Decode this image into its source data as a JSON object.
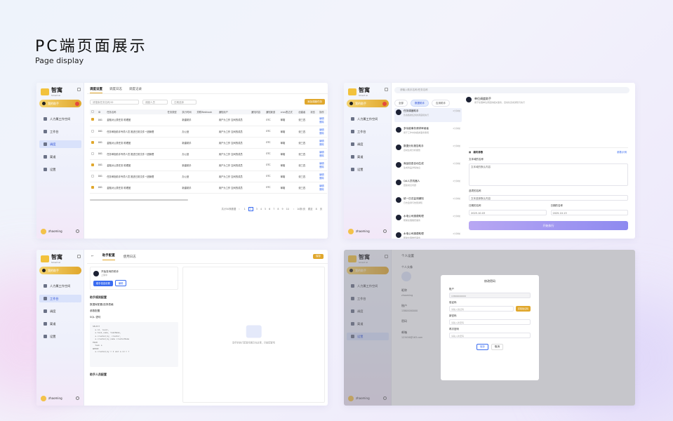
{
  "heading": {
    "title": "PC端页面展示",
    "subtitle": "Page display"
  },
  "brand": {
    "name": "智寓",
    "tagline": "Smart AI"
  },
  "sidebar": {
    "new_label": "我的助手",
    "items": [
      {
        "label": "人力属工作空间"
      },
      {
        "label": "工作台"
      },
      {
        "label": "调度"
      },
      {
        "label": "渠道"
      },
      {
        "label": "设置"
      }
    ],
    "user_name": "zhaoming"
  },
  "panel1": {
    "tabs": [
      "调度设置",
      "调度日志",
      "调度记录"
    ],
    "search_placeholder": "请搜索任务名称/ID",
    "filter_type": "调度人员",
    "filter_date": "日期选择",
    "add_label": "添加调度任务",
    "columns": [
      "ID",
      "任务名称",
      "任务类型",
      "执行时间",
      "关联Webhook",
      "通知用户",
      "通知内容",
      "通知渠道",
      "cron表达式",
      "创建者",
      "状态",
      "操作"
    ],
    "rows": [
      {
        "checked": true,
        "id": "001",
        "name": "金融对公类任务 助理团",
        "time": "新建助手",
        "users": "用户为工作 空间的成员",
        "channel": "OTC",
        "cron": "邮箱",
        "creator": "张三四",
        "op1": "编辑",
        "op2": "删除"
      },
      {
        "checked": false,
        "id": "001",
        "name": "任务审批助手专项人员 推进日常文件一团管理",
        "time": "办公室",
        "users": "用户为工作 空间的成员",
        "channel": "OTC",
        "cron": "邮箱",
        "creator": "张三四",
        "op1": "编辑",
        "op2": "删除"
      },
      {
        "checked": true,
        "id": "001",
        "name": "金融对公类任务 助理团",
        "time": "新建助手",
        "users": "用户为工作 空间的成员",
        "channel": "OTC",
        "cron": "邮箱",
        "creator": "张三四",
        "op1": "编辑",
        "op2": "删除"
      },
      {
        "checked": false,
        "id": "001",
        "name": "任务审批助手专项人员 推进日常文件一团管理",
        "time": "办公室",
        "users": "用户为工作 空间的成员",
        "channel": "OTC",
        "cron": "邮箱",
        "creator": "张三四",
        "op1": "编辑",
        "op2": "删除"
      },
      {
        "checked": true,
        "id": "001",
        "name": "金融对公类任务 助理团",
        "time": "新建助手",
        "users": "用户为工作 空间的成员",
        "channel": "OTC",
        "cron": "邮箱",
        "creator": "张三四",
        "op1": "编辑",
        "op2": "删除"
      },
      {
        "checked": false,
        "id": "001",
        "name": "任务审批助手专项人员 推进日常文件一团管理",
        "time": "办公室",
        "users": "用户为工作 空间的成员",
        "channel": "OTC",
        "cron": "邮箱",
        "creator": "张三四",
        "op1": "编辑",
        "op2": "删除"
      },
      {
        "checked": true,
        "id": "001",
        "name": "金融对公类任务 助理团",
        "time": "新建助手",
        "users": "用户为工作 空间的成员",
        "channel": "OTC",
        "cron": "邮箱",
        "creator": "张三四",
        "op1": "编辑",
        "op2": "删除"
      }
    ],
    "pager": {
      "total": "共计50条数据",
      "pages": [
        "1",
        "2",
        "3",
        "4",
        "5",
        "6",
        "7",
        "8",
        "9",
        "10"
      ],
      "current": "2",
      "size": "10条/页",
      "goto": "跳至",
      "page_no": "8",
      "page_unit": "页"
    }
  },
  "panel2": {
    "search_placeholder": "请输入助手名称/任务名称",
    "chips": [
      "全部",
      "数据助手",
      "应用助手"
    ],
    "assistants": [
      {
        "name": "任务调度助手",
        "desc": "负责各类任务的调度和执行",
        "time": "4分钟前"
      },
      {
        "name": "多功能事务请求审阅者",
        "desc": "用于工作中的各类事务审阅",
        "time": "4分钟前"
      },
      {
        "name": "数据分析报告助手",
        "desc": "自动生成分析报告",
        "time": "4分钟前"
      },
      {
        "name": "商品信息自动生成",
        "desc": "生成商品详情信息",
        "time": "4分钟前"
      },
      {
        "name": "QA人员机器人",
        "desc": "回答常见问题",
        "time": "4分钟前"
      },
      {
        "name": "统一日志监测通知",
        "desc": "日志监测与告警通知",
        "time": "4分钟前"
      },
      {
        "name": "水电公司缴费助理",
        "desc": "帮助处理缴费事务",
        "time": "4分钟前"
      },
      {
        "name": "水电公司缴费助理",
        "desc": "帮助处理缴费事务",
        "time": "4分钟前"
      }
    ],
    "detail": {
      "name": "单位调度助手",
      "desc": "用于处理单位调度的相关事务，自动化完成通知与执行",
      "form_title": "填写参数",
      "form_link": "参数示例",
      "field1": "文本域的名称",
      "field1_value": "文本域的默认内容",
      "field2": "选项的名称",
      "field2_value": "文本选择默认内容",
      "date1_label": "日期的名称",
      "date1_value": "2025.10.03",
      "date2_label": "日期的名称",
      "date2_value": "2025.10.13",
      "exec": "开始执行"
    }
  },
  "panel3": {
    "tabs": [
      "助手配置",
      "使用日志"
    ],
    "save": "保存",
    "assistant_name": "开始查询的助手",
    "assistant_sub": "上架中",
    "btn_primary": "助手信息设置",
    "btn_secondary": "编辑",
    "sec1": "助手规则配置",
    "opt1": "数据库配置/选择表格",
    "opt2": "参数配置",
    "opt3": "SQL 语句",
    "sql": "SELECT\n  a.id, level,\n  a.task_name, taskName,\n  a.created_by, creator,\n  a.created_by_name creatorName\nFROM\n  task a\nWHERE\n  a.created_by = 2 and a.id = ?",
    "sec2": "助手人员配置",
    "empty_text": "助手的执行配置将展示在这里，开始配置吧"
  },
  "panel4": {
    "tab": "个人设置",
    "avatar_label": "个人头像",
    "nick_label": "昵称",
    "nick_value": "zhaoming",
    "account_label": "账户",
    "account_value": "13800000000",
    "pwd_label": "密码",
    "email_label": "邮箱",
    "email_value": "123456@163.com",
    "modal": {
      "title": "修改密码",
      "account_label": "账户",
      "account_value": "13800000000",
      "code_label": "验证码",
      "code_ph": "请输入验证码",
      "code_btn": "获取验证码",
      "new_label": "新密码",
      "new_ph": "请输入新密码",
      "confirm_label": "再次密码",
      "confirm_ph": "请输入新密码",
      "ok": "保存",
      "cancel": "取消"
    }
  },
  "colors": {
    "accent": "#e0a72c",
    "primary": "#3a6cf0",
    "active_nav": "#d9e2fb"
  }
}
